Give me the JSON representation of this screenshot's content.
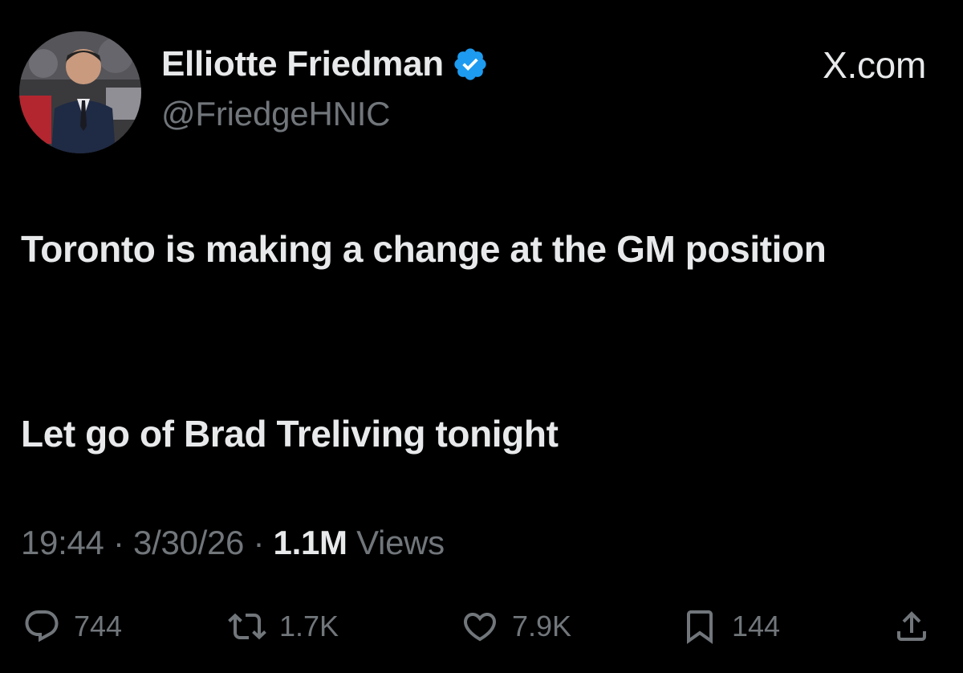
{
  "author": {
    "display_name": "Elliotte Friedman",
    "handle": "@FriedgeHNIC",
    "verified": true,
    "verified_color": "#1d9bf0"
  },
  "source": "X.com",
  "tweet": {
    "line1": "Toronto is making a change at the GM position",
    "line2": "Let go of Brad Treliving tonight"
  },
  "meta": {
    "time": "19:44",
    "separator": " · ",
    "date": "3/30/26",
    "views_count": "1.1M",
    "views_label": "Views"
  },
  "actions": {
    "replies": "744",
    "reposts": "1.7K",
    "likes": "7.9K",
    "bookmarks": "144"
  },
  "icons": [
    "verified-badge-icon",
    "reply-icon",
    "repost-icon",
    "like-icon",
    "bookmark-icon",
    "share-icon"
  ],
  "colors": {
    "background": "#000000",
    "primary_text": "#e7e9ea",
    "secondary_text": "#71767b"
  }
}
